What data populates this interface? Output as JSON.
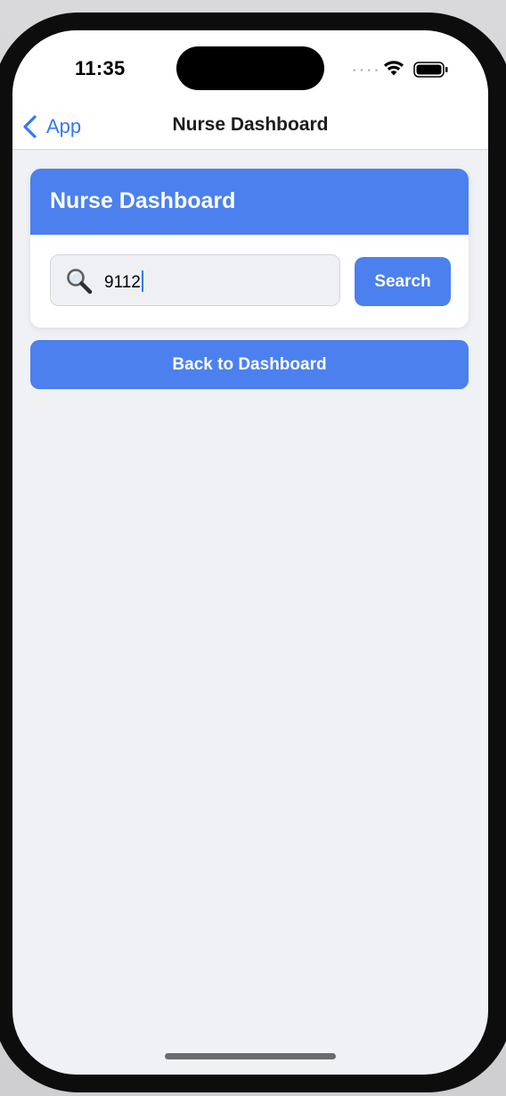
{
  "status_bar": {
    "time": "11:35",
    "signal_dots": "• • • •",
    "wifi_icon": "wifi-icon",
    "battery_icon": "battery-icon"
  },
  "nav": {
    "back_label": "App",
    "back_icon": "chevron-left-icon",
    "title": "Nurse Dashboard"
  },
  "card": {
    "title": "Nurse Dashboard",
    "search": {
      "value": "9112",
      "icon": "search-icon"
    },
    "search_button_label": "Search"
  },
  "back_button_label": "Back to Dashboard",
  "colors": {
    "accent": "#4b80ee",
    "ios_link": "#3478f6",
    "background": "#f0f1f4"
  }
}
